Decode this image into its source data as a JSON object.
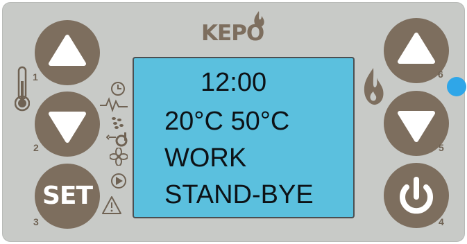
{
  "brand": {
    "name": "KEPO"
  },
  "colors": {
    "panel": "#c8cac7",
    "button": "#7d6e5e",
    "lcd_background": "#5bc0de",
    "lcd_text": "#0d1216",
    "indicator_led": "#2fa6e8"
  },
  "buttons": {
    "b1": {
      "number": "1",
      "icon": "triangle-up-icon"
    },
    "b2": {
      "number": "2",
      "icon": "triangle-down-icon"
    },
    "b3": {
      "number": "3",
      "label": "SET"
    },
    "b4": {
      "number": "4",
      "icon": "power-icon"
    },
    "b5": {
      "number": "5",
      "icon": "triangle-down-icon"
    },
    "b6": {
      "number": "6",
      "icon": "triangle-up-icon"
    }
  },
  "display": {
    "time": "12:00",
    "temps": "20°C 50°C",
    "status": "WORK",
    "mode": "STAND-BYE"
  },
  "status_icons": [
    "clock-icon",
    "heartbeat-icon",
    "pellets-icon",
    "fan-icon",
    "pump-icon",
    "warning-icon"
  ],
  "side_icons": [
    "thermometer-icon",
    "flame-icon"
  ],
  "indicator": {
    "state": "on",
    "color": "#2fa6e8"
  }
}
